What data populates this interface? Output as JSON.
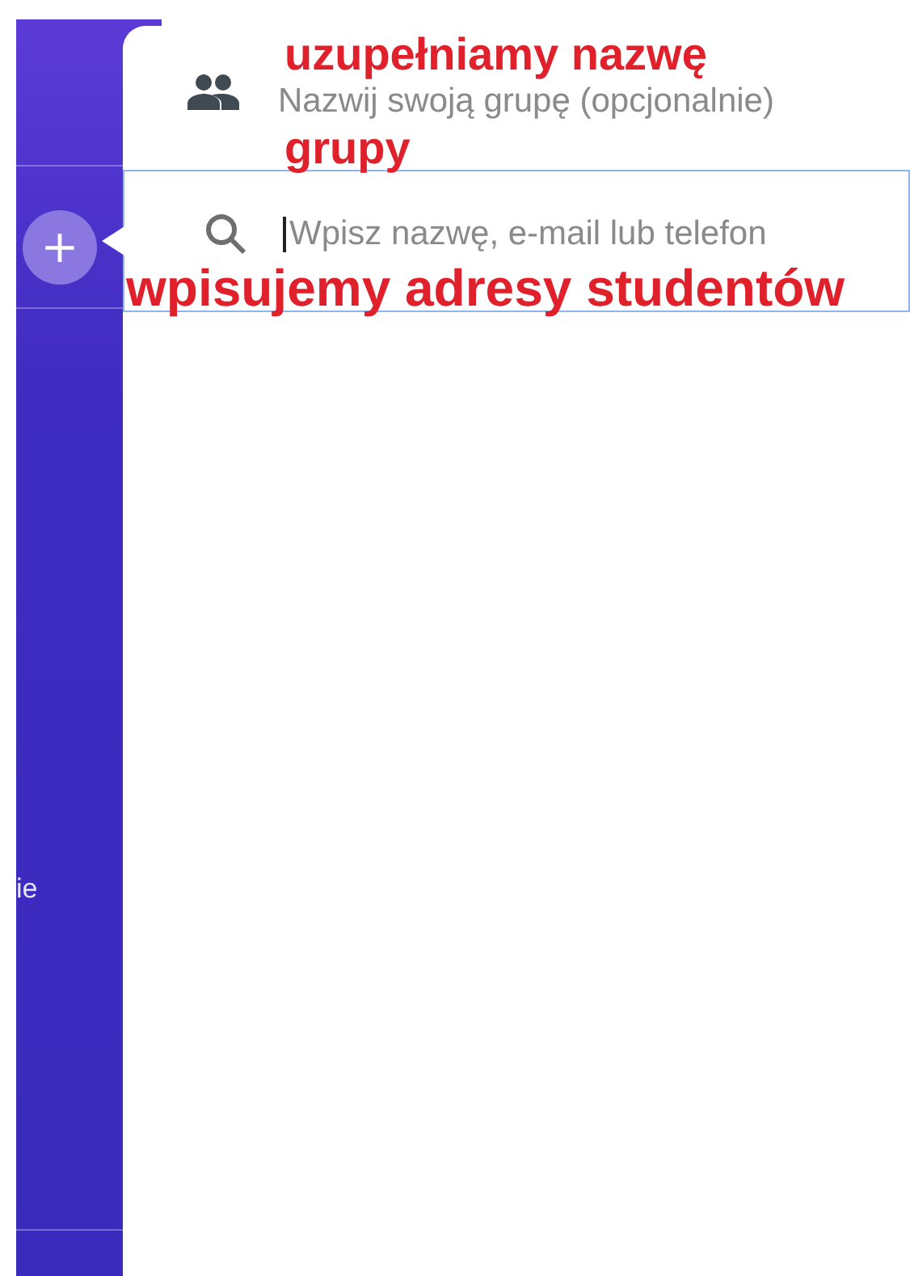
{
  "sidebar": {
    "add_button": "+",
    "label": "ie"
  },
  "group_name": {
    "placeholder": "Nazwij swoją grupę (opcjonalnie)"
  },
  "search": {
    "placeholder": "Wpisz nazwę, e-mail lub telefon"
  },
  "annotations": [
    {
      "text": "uzupełniamy nazwę"
    },
    {
      "text": "grupy"
    },
    {
      "text": "wpisujemy adresy studentów"
    }
  ]
}
